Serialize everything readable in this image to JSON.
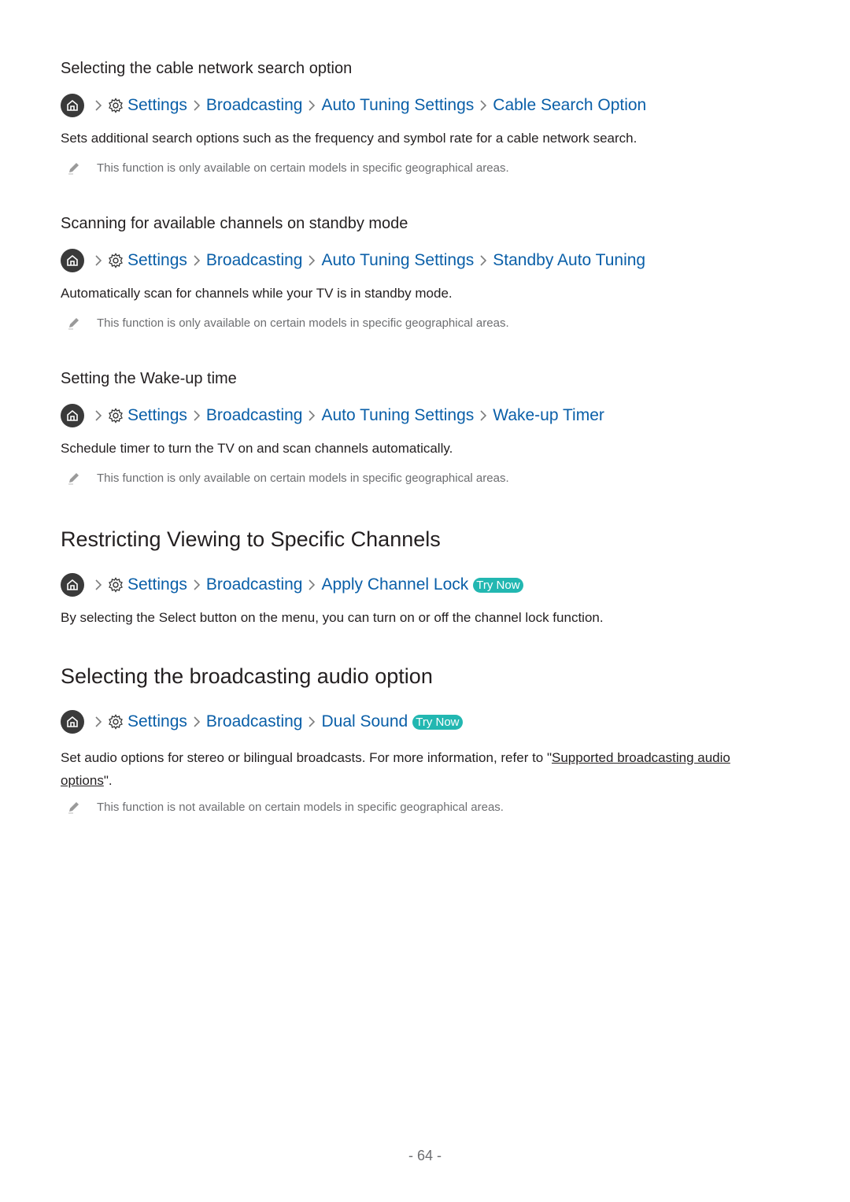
{
  "sections": [
    {
      "heading": "Selecting the cable network search option",
      "path": [
        "Settings",
        "Broadcasting",
        "Auto Tuning Settings",
        "Cable Search Option"
      ],
      "description": "Sets additional search options such as the frequency and symbol rate for a cable network search.",
      "note": "This function is only available on certain models in specific geographical areas."
    },
    {
      "heading": "Scanning for available channels on standby mode",
      "path": [
        "Settings",
        "Broadcasting",
        "Auto Tuning Settings",
        "Standby Auto Tuning"
      ],
      "description": "Automatically scan for channels while your TV is in standby mode.",
      "note": "This function is only available on certain models in specific geographical areas."
    },
    {
      "heading": "Setting the Wake-up time",
      "path": [
        "Settings",
        "Broadcasting",
        "Auto Tuning Settings",
        "Wake-up Timer"
      ],
      "description": "Schedule timer to turn the TV on and scan channels automatically.",
      "note": "This function is only available on certain models in specific geographical areas."
    },
    {
      "heading": "Restricting Viewing to Specific Channels",
      "path": [
        "Settings",
        "Broadcasting",
        "Apply Channel Lock"
      ],
      "try_now": "Try Now",
      "description": "By selecting the Select button on the menu, you can turn on or off the channel lock function."
    },
    {
      "heading": "Selecting the broadcasting audio option",
      "path": [
        "Settings",
        "Broadcasting",
        "Dual Sound"
      ],
      "try_now": "Try Now",
      "description_pre": "Set audio options for stereo or bilingual broadcasts. For more information, refer to \"",
      "description_link_1": "Supported broadcasting audio ",
      "description_link_2": "options",
      "description_post": "\".",
      "note": "This function is not available on certain models in specific geographical areas."
    }
  ],
  "page_number": "- 64 -",
  "colors": {
    "link": "#0a5fa8",
    "try_now": "#22b7b1",
    "text": "#231f20",
    "note": "#6d6e71"
  }
}
